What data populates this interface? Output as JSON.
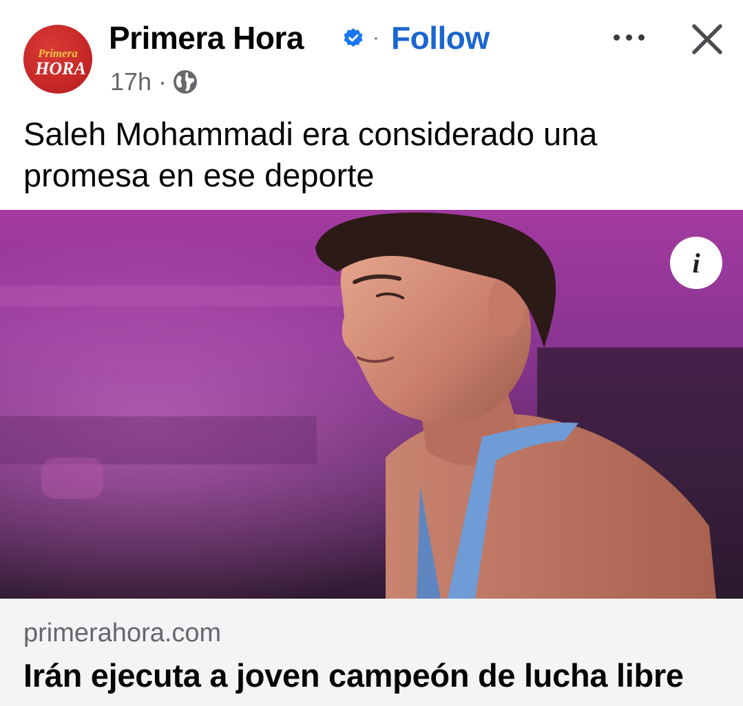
{
  "post": {
    "page_name": "Primera Hora",
    "follow_label": "Follow",
    "name_separator": "·",
    "timestamp": "17h",
    "meta_separator": "·",
    "privacy_icon": "globe-icon",
    "verified_icon": "verified-badge-icon",
    "more_icon": "more-options-icon",
    "close_icon": "close-icon",
    "caption": "Saleh Mohammadi era considerado una promesa en ese deporte"
  },
  "avatar": {
    "logo_top": "Primera",
    "logo_bottom": "HORA"
  },
  "image": {
    "info_label": "i"
  },
  "link_preview": {
    "domain": "primerahora.com",
    "title": "Irán ejecuta a joven campeón de lucha libre"
  },
  "colors": {
    "follow": "#1b66cf",
    "verified": "#1877f2",
    "avatar_red": "#c62828",
    "secondary_text": "#65676b",
    "preview_bg": "#f3f4f6"
  }
}
